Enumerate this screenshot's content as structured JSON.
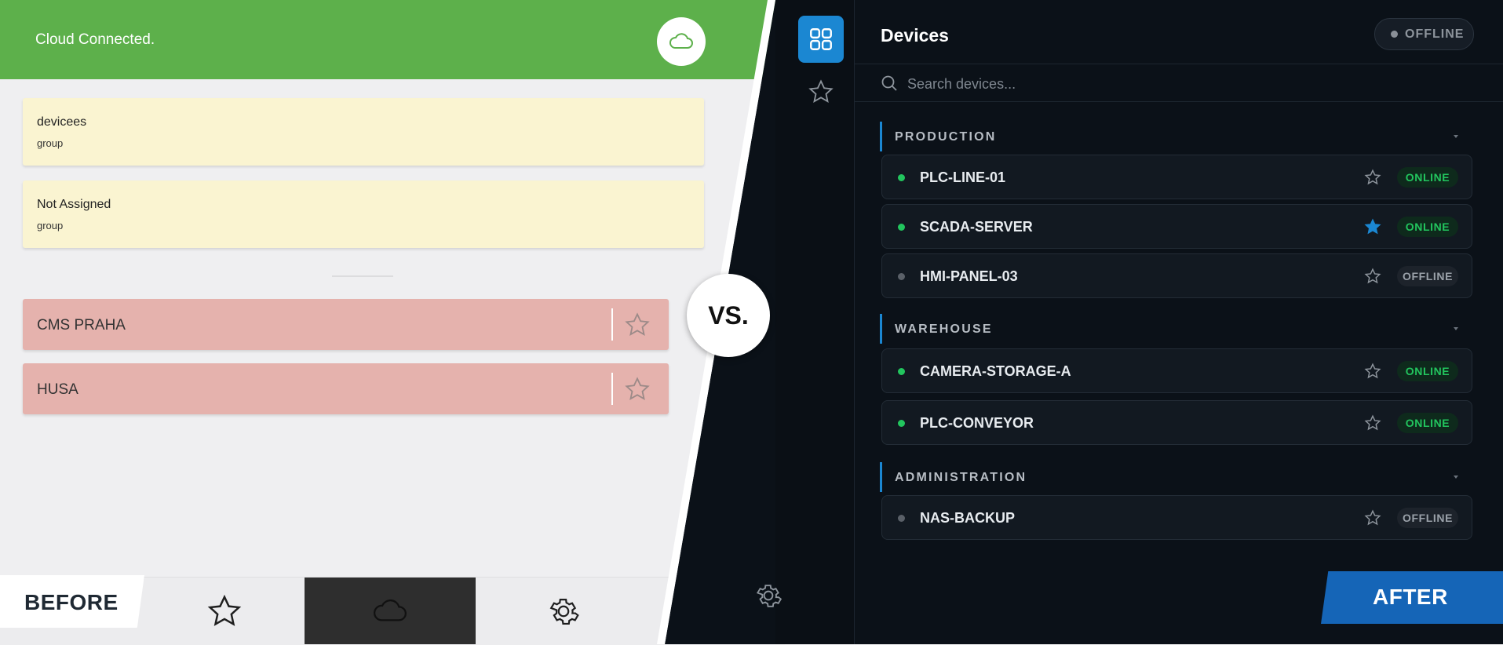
{
  "before": {
    "header_title": "Cloud Connected.",
    "groups": [
      {
        "name": "devicees",
        "sub": "group"
      },
      {
        "name": "Not Assigned",
        "sub": "group"
      }
    ],
    "devices": [
      {
        "name": "CMS PRAHA"
      },
      {
        "name": "HUSA"
      }
    ],
    "label": "BEFORE",
    "tabs": [
      "star-icon",
      "cloud-icon",
      "gear-icon"
    ]
  },
  "vs_label": "VS.",
  "after": {
    "title": "Devices",
    "status": "OFFLINE",
    "search_placeholder": "Search devices...",
    "sections": [
      {
        "label": "PRODUCTION",
        "rows": [
          {
            "name": "PLC-LINE-01",
            "status": "ONLINE",
            "favorite": false
          },
          {
            "name": "SCADA-SERVER",
            "status": "ONLINE",
            "favorite": true
          },
          {
            "name": "HMI-PANEL-03",
            "status": "OFFLINE",
            "favorite": false
          }
        ]
      },
      {
        "label": "WAREHOUSE",
        "rows": [
          {
            "name": "CAMERA-STORAGE-A",
            "status": "ONLINE",
            "favorite": false
          },
          {
            "name": "PLC-CONVEYOR",
            "status": "ONLINE",
            "favorite": false
          }
        ]
      },
      {
        "label": "ADMINISTRATION",
        "rows": [
          {
            "name": "NAS-BACKUP",
            "status": "OFFLINE",
            "favorite": false
          }
        ]
      }
    ],
    "label": "AFTER"
  },
  "colors": {
    "before_header": "#5db04b",
    "group_card": "#faf4d1",
    "device_card": "#e5b2ad",
    "after_bg": "#0b1118",
    "accent": "#1b87d2",
    "online": "#22c55e",
    "offline": "#8a9098"
  }
}
